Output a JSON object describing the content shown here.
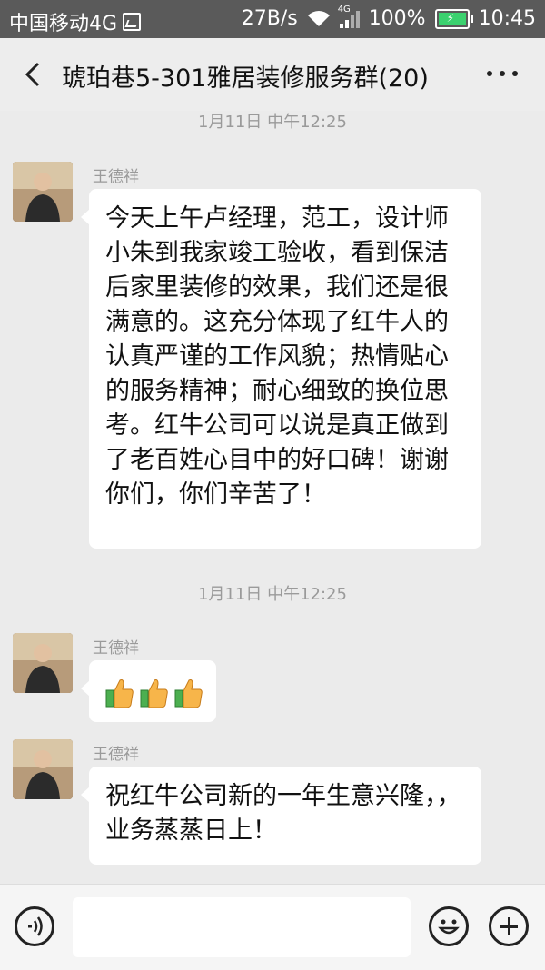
{
  "status_bar": {
    "carrier": "中国移动4G",
    "net_speed": "27B/s",
    "signal_tag": "4G",
    "battery": "100%",
    "time": "10:45"
  },
  "header": {
    "title": "琥珀巷5-301雅居装修服务群(20)"
  },
  "messages": [
    {
      "timestamp": "1月11日 中午12:25",
      "sender": "王德祥",
      "text_lines": [
        "今天上午卢经理，范工，设计师",
        "小朱到我家竣工验收，看到保洁",
        "后家里装修的效果，我们还是很",
        "满意的。这充分体现了红牛人的",
        "认真严谨的工作风貌；热情贴心",
        "的服务精神；耐心细致的换位思",
        "考。红牛公司可以说是真正做到",
        "了老百姓心目中的好口碑！谢谢",
        "你们，你们辛苦了！"
      ]
    },
    {
      "timestamp": "1月11日 中午12:25",
      "sender": "王德祥",
      "emoji": [
        "thumbs-up",
        "thumbs-up",
        "thumbs-up"
      ]
    },
    {
      "sender": "王德祥",
      "text_lines": [
        "祝红牛公司新的一年生意兴隆，，",
        "业务蒸蒸日上！"
      ]
    }
  ],
  "input": {
    "value": "",
    "placeholder": ""
  },
  "icons": {
    "back": "chevron-left-icon",
    "more": "more-dots-icon",
    "voice": "voice-icon",
    "emoji": "smiley-icon",
    "plus": "plus-icon"
  }
}
